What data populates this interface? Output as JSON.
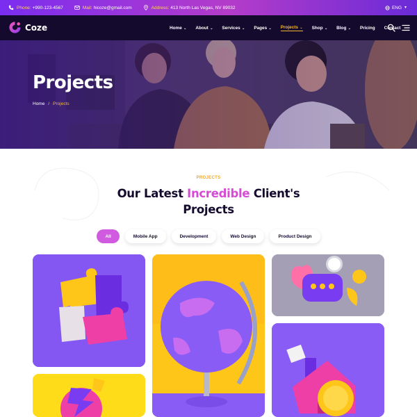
{
  "topbar": {
    "phone_label": "Phone:",
    "phone_value": "+990-123-4567",
    "mail_label": "Mail:",
    "mail_value": "hicoze@gmail.com",
    "address_label": "Address:",
    "address_value": "413 North Las Vegas, NV 89032",
    "language": "ENG",
    "icons": [
      "phone-icon",
      "mail-icon",
      "location-icon",
      "globe-icon"
    ]
  },
  "nav": {
    "logo_text": "Coze",
    "menu": [
      {
        "label": "Home",
        "dropdown": true
      },
      {
        "label": "About",
        "dropdown": true
      },
      {
        "label": "Services",
        "dropdown": true
      },
      {
        "label": "Pages",
        "dropdown": true
      },
      {
        "label": "Projects",
        "dropdown": true,
        "active": true
      },
      {
        "label": "Shop",
        "dropdown": true
      },
      {
        "label": "Blog",
        "dropdown": true
      },
      {
        "label": "Pricing",
        "dropdown": false
      },
      {
        "label": "Contact",
        "dropdown": false
      }
    ]
  },
  "hero": {
    "title": "Projects",
    "breadcrumb_home": "Home",
    "breadcrumb_separator": "/",
    "breadcrumb_current": "Projects"
  },
  "section": {
    "eyebrow": "PROJECTS",
    "heading_part1": "Our Latest",
    "heading_highlight": "Incredible",
    "heading_part2": "Client's",
    "heading_line2": "Projects"
  },
  "filters": [
    {
      "label": "All",
      "active": true
    },
    {
      "label": "Mobile App",
      "active": false
    },
    {
      "label": "Development",
      "active": false
    },
    {
      "label": "Web Design",
      "active": false
    },
    {
      "label": "Product Design",
      "active": false
    }
  ],
  "colors": {
    "accent": "#d05ae0",
    "highlight": "#d64ad6",
    "gold": "#f2b632",
    "dark": "#140a2e"
  }
}
